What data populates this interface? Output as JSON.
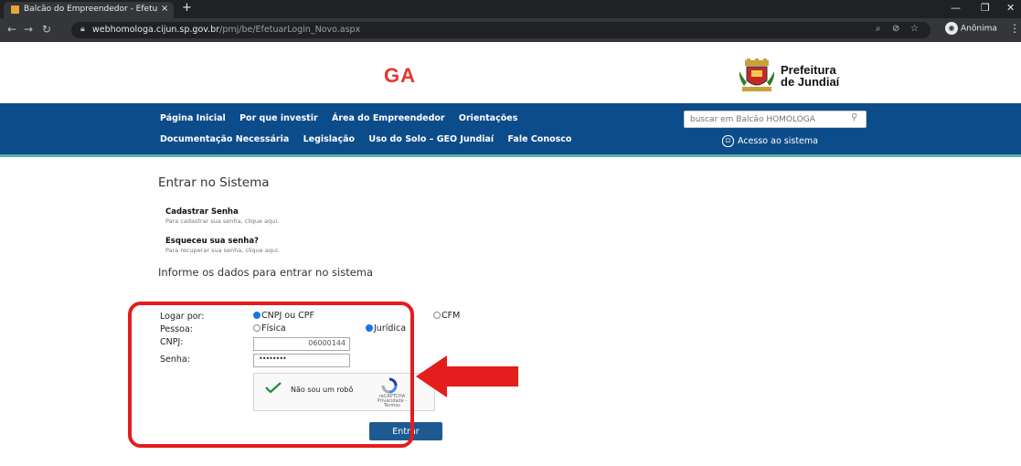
{
  "browser": {
    "tab_title": "Balcão do Empreendedor - Efetu",
    "tab_close": "×",
    "new_tab": "+",
    "url_host": "webhomologa.cijun.sp.gov.br",
    "url_path": "/pmj/be/EfetuarLogin_Novo.aspx",
    "incognito_label": "Anônima"
  },
  "header": {
    "logo_text": "GA",
    "city_line1": "Prefeitura",
    "city_line2": "de Jundiaí"
  },
  "nav": {
    "row1": [
      "Página Inicial",
      "Por que investir",
      "Área do Empreendedor",
      "Orientações"
    ],
    "row2": [
      "Documentação Necessária",
      "Legislação",
      "Uso do Solo – GEO Jundiaí",
      "Fale Conosco"
    ],
    "search_placeholder": "buscar em Balcão HOMOLOGA",
    "access_label": "Acesso ao sistema"
  },
  "content": {
    "title": "Entrar no Sistema",
    "register_title": "Cadastrar Senha",
    "register_sub": "Para cadastrar sua senha, clique aqui.",
    "forgot_title": "Esqueceu sua senha?",
    "forgot_sub": "Para recuperar sua senha, clique aqui.",
    "subtitle": "Informe os dados para entrar no sistema"
  },
  "form": {
    "login_by_label": "Logar por:",
    "opt_cnpj_cpf": "CNPJ ou CPF",
    "opt_cfm": "CFM",
    "person_label": "Pessoa:",
    "opt_fisica": "Física",
    "opt_juridica": "Jurídica",
    "cnpj_label": "CNPJ:",
    "cnpj_value": "06000144",
    "password_label": "Senha:",
    "password_value": "••••••••",
    "captcha_text": "Não sou um robô",
    "captcha_brand": "reCAPTCHA",
    "captcha_links": "Privacidade - Termos",
    "submit_label": "Entrar"
  },
  "colors": {
    "nav_bg": "#0d4c8b",
    "highlight": "#e41d1d",
    "logo_red": "#e3372e"
  }
}
